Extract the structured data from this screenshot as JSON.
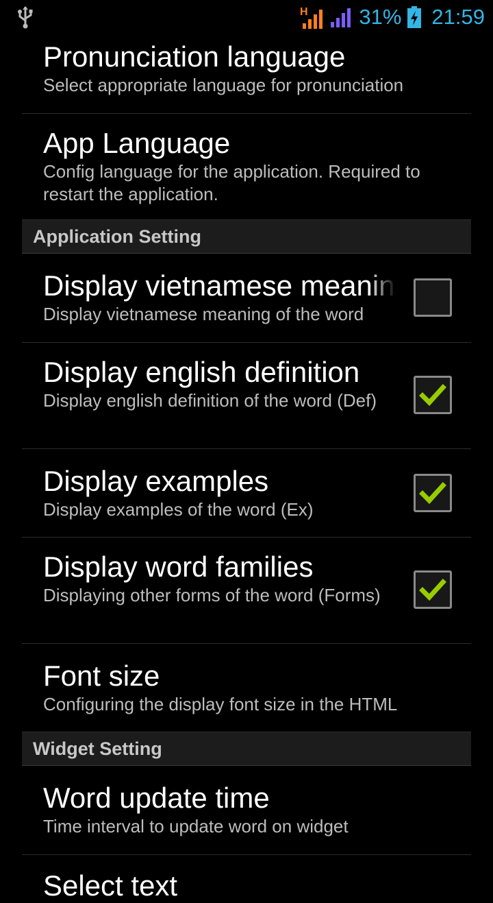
{
  "status_bar": {
    "usb_icon": "usb-icon",
    "network_type": "H",
    "battery_percent": "31%",
    "time": "21:59",
    "accent_color": "#33b5e5"
  },
  "prefs": {
    "pronunciation": {
      "title": "Pronunciation language",
      "summary": "Select appropriate language for pronunciation"
    },
    "app_language": {
      "title": "App Language",
      "summary": "Config language for the application. Required to restart the application."
    },
    "category_application": "Application Setting",
    "vietnamese": {
      "title": "Display vietnamese meaning",
      "summary": "Display vietnamese meaning of the word",
      "checked": false
    },
    "english": {
      "title": "Display english definition",
      "summary": "Display english definition of the word (Def)",
      "checked": true
    },
    "examples": {
      "title": "Display examples",
      "summary": "Display examples of the word (Ex)",
      "checked": true
    },
    "families": {
      "title": "Display word families",
      "summary": "Displaying other forms of the word (Forms)",
      "checked": true
    },
    "font_size": {
      "title": "Font size",
      "summary": "Configuring the display font size in the HTML"
    },
    "category_widget": "Widget Setting",
    "word_update": {
      "title": "Word update time",
      "summary": "Time interval to update word on widget"
    },
    "next_partial": {
      "title": "Select text"
    }
  },
  "colors": {
    "check_green": "#99cc00",
    "summary_gray": "#bdbdbd",
    "category_bg": "#1c1c1c"
  }
}
